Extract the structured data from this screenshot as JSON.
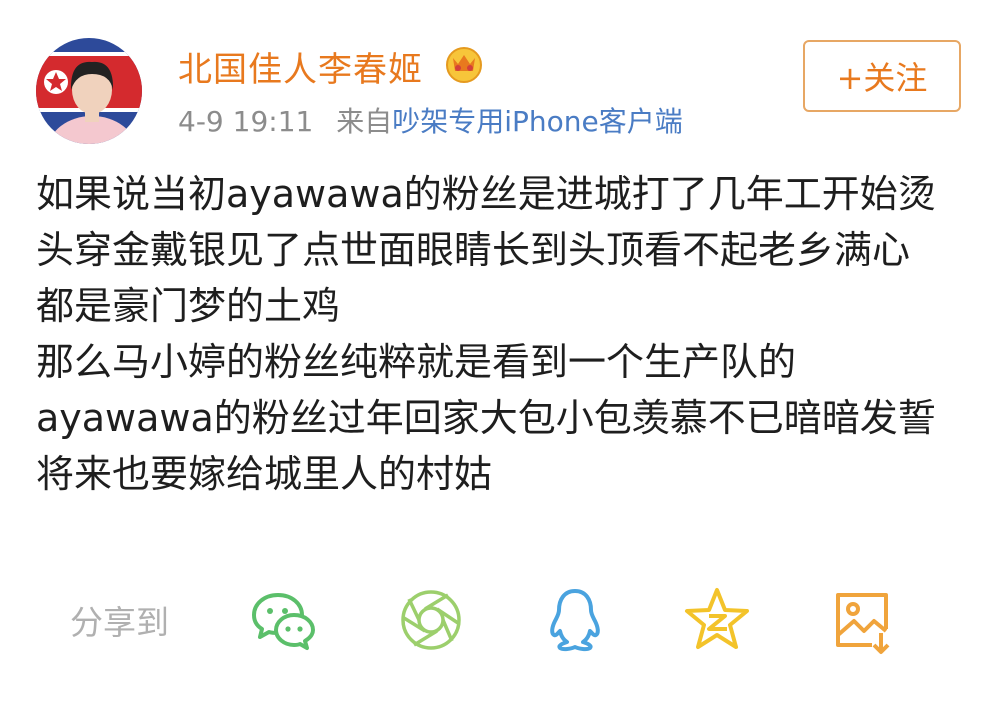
{
  "author": {
    "name": "北国佳人李春姬",
    "avatar_icon": "profile-photo",
    "vip_icon": "crown-badge-icon"
  },
  "meta": {
    "time": "4-9 19:11",
    "source_prefix": "来自",
    "source_name": "吵架专用iPhone客户端"
  },
  "follow_button": {
    "label": "+关注"
  },
  "post": {
    "lines": [
      "如果说当初ayawawa的粉丝是进城打了几年工开始烫",
      "头穿金戴银见了点世面眼睛长到头顶看不起老乡满心",
      "都是豪门梦的土鸡",
      "那么马小婷的粉丝纯粹就是看到一个生产队的",
      "ayawawa的粉丝过年回家大包小包羡慕不已暗暗发誓",
      "将来也要嫁给城里人的村姑"
    ]
  },
  "share": {
    "label": "分享到",
    "icons": [
      "wechat-icon",
      "moments-icon",
      "qq-icon",
      "qzone-icon",
      "save-image-icon"
    ]
  },
  "colors": {
    "accent": "#e8791e",
    "link": "#4a7cc4",
    "meta": "#8c8c8c",
    "wechat": "#5bbf6a",
    "moments": "#9ccf6c",
    "qq": "#4aa3df",
    "qzone": "#f3c32a",
    "save": "#f0a43c"
  }
}
